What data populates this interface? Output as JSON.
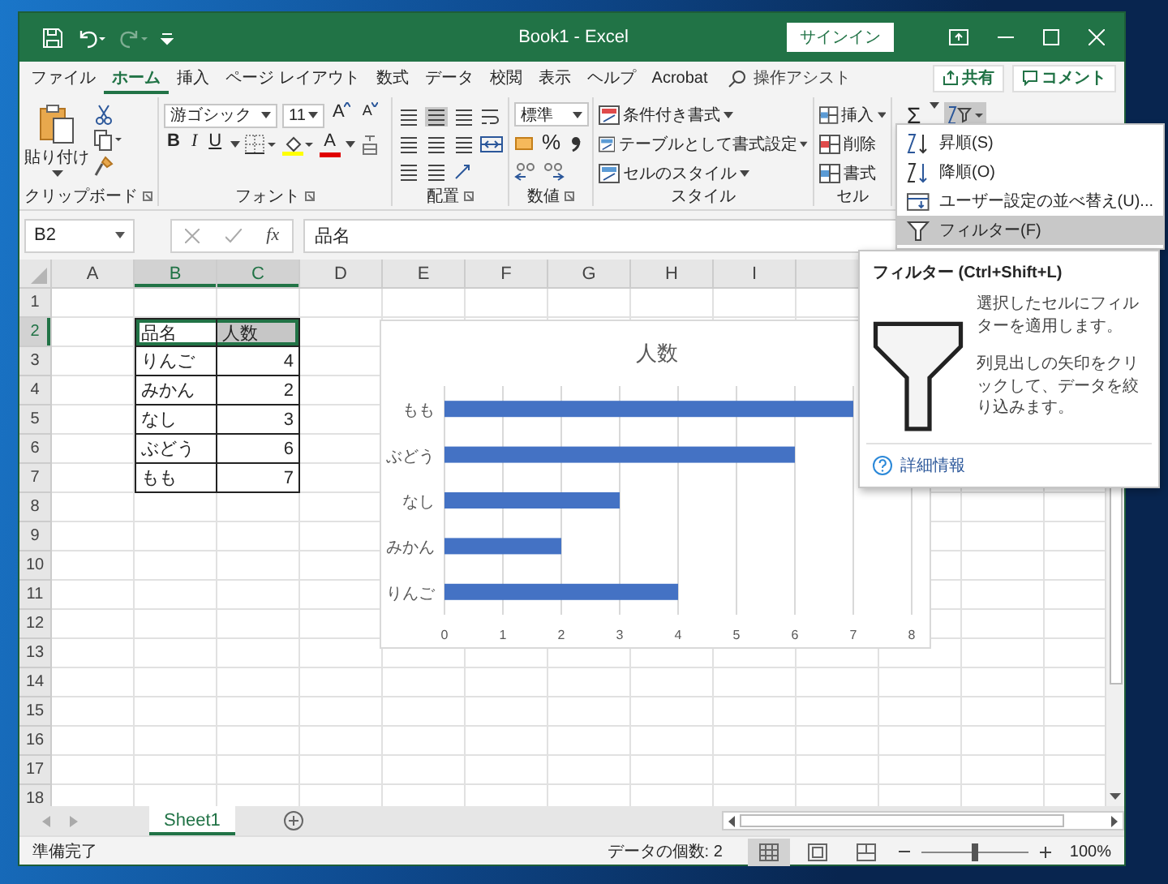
{
  "window": {
    "title": "Book1 - Excel",
    "sign_in": "サインイン"
  },
  "tabs": [
    {
      "label": "ファイル",
      "selected": false
    },
    {
      "label": "ホーム",
      "selected": true
    },
    {
      "label": "挿入",
      "selected": false
    },
    {
      "label": "ページ レイアウト",
      "selected": false
    },
    {
      "label": "数式",
      "selected": false
    },
    {
      "label": "データ",
      "selected": false
    },
    {
      "label": "校閲",
      "selected": false
    },
    {
      "label": "表示",
      "selected": false
    },
    {
      "label": "ヘルプ",
      "selected": false
    },
    {
      "label": "Acrobat",
      "selected": false
    }
  ],
  "tell_me": {
    "placeholder": "操作アシスト"
  },
  "share_button": "共有",
  "comment_button": "コメント",
  "ribbon": {
    "clipboard": {
      "paste": "貼り付け",
      "label": "クリップボード"
    },
    "font": {
      "name": "游ゴシック",
      "size": "11",
      "grow": "A",
      "shrink": "A",
      "bold": "B",
      "italic": "I",
      "underline": "U",
      "font_color": "A",
      "label": "フォント"
    },
    "alignment": {
      "label": "配置"
    },
    "number": {
      "format": "標準",
      "percent": "%",
      "label": "数値"
    },
    "styles": {
      "buttons": [
        "条件付き書式",
        "テーブルとして書式設定",
        "セルのスタイル"
      ],
      "label": "スタイル"
    },
    "cells": {
      "buttons": [
        "挿入",
        "削除",
        "書式"
      ],
      "label": "セル"
    },
    "editing": {
      "sum": "Σ"
    }
  },
  "sort_menu": {
    "items": [
      {
        "label": "昇順(S)",
        "selected": false
      },
      {
        "label": "降順(O)",
        "selected": false
      },
      {
        "label": "ユーザー設定の並べ替え(U)...",
        "selected": false
      },
      {
        "label": "フィルター(F)",
        "selected": true
      }
    ]
  },
  "tooltip": {
    "title": "フィルター (Ctrl+Shift+L)",
    "paragraphs": [
      "選択したセルにフィルターを適用します。",
      "列見出しの矢印をクリックして、データを絞り込みます。"
    ],
    "link": "詳細情報"
  },
  "formula_bar": {
    "name_box": "B2",
    "fx": "fx",
    "value": "品名"
  },
  "sheet": {
    "columns": [
      {
        "label": "A",
        "selected": false
      },
      {
        "label": "B",
        "selected": true
      },
      {
        "label": "C",
        "selected": true
      },
      {
        "label": "D",
        "selected": false
      },
      {
        "label": "E",
        "selected": false
      },
      {
        "label": "F",
        "selected": false
      },
      {
        "label": "G",
        "selected": false
      },
      {
        "label": "H",
        "selected": false
      },
      {
        "label": "I",
        "selected": false
      }
    ],
    "rows": [
      {
        "label": "1",
        "selected": false
      },
      {
        "label": "2",
        "selected": true
      },
      {
        "label": "3",
        "selected": false
      },
      {
        "label": "4",
        "selected": false
      },
      {
        "label": "5",
        "selected": false
      },
      {
        "label": "6",
        "selected": false
      },
      {
        "label": "7",
        "selected": false
      },
      {
        "label": "8",
        "selected": false
      },
      {
        "label": "9",
        "selected": false
      },
      {
        "label": "10",
        "selected": false
      },
      {
        "label": "11",
        "selected": false
      },
      {
        "label": "12",
        "selected": false
      },
      {
        "label": "13",
        "selected": false
      },
      {
        "label": "14",
        "selected": false
      },
      {
        "label": "15",
        "selected": false
      },
      {
        "label": "16",
        "selected": false
      },
      {
        "label": "17",
        "selected": false
      },
      {
        "label": "18",
        "selected": false
      }
    ]
  },
  "table": {
    "rows": [
      {
        "cells": [
          {
            "text": "品名",
            "kind": "text",
            "selected": true,
            "active": true
          },
          {
            "text": "人数",
            "kind": "text",
            "selected": true,
            "active": false
          }
        ]
      },
      {
        "cells": [
          {
            "text": "りんご",
            "kind": "text",
            "selected": false,
            "active": false
          },
          {
            "text": "4",
            "kind": "number",
            "selected": false,
            "active": false
          }
        ]
      },
      {
        "cells": [
          {
            "text": "みかん",
            "kind": "text",
            "selected": false,
            "active": false
          },
          {
            "text": "2",
            "kind": "number",
            "selected": false,
            "active": false
          }
        ]
      },
      {
        "cells": [
          {
            "text": "なし",
            "kind": "text",
            "selected": false,
            "active": false
          },
          {
            "text": "3",
            "kind": "number",
            "selected": false,
            "active": false
          }
        ]
      },
      {
        "cells": [
          {
            "text": "ぶどう",
            "kind": "text",
            "selected": false,
            "active": false
          },
          {
            "text": "6",
            "kind": "number",
            "selected": false,
            "active": false
          }
        ]
      },
      {
        "cells": [
          {
            "text": "もも",
            "kind": "text",
            "selected": false,
            "active": false
          },
          {
            "text": "7",
            "kind": "number",
            "selected": false,
            "active": false
          }
        ]
      }
    ]
  },
  "chart": {
    "chart_data": {
      "type": "bar",
      "orientation": "horizontal",
      "title": "人数",
      "categories": [
        "もも",
        "ぶどう",
        "なし",
        "みかん",
        "りんご"
      ],
      "series": [
        {
          "color": "#4472c4",
          "values": [
            7,
            6,
            3,
            2,
            4
          ]
        }
      ],
      "xlim": [
        0,
        8
      ],
      "xticks": [
        0,
        1,
        2,
        3,
        4,
        5,
        6,
        7,
        8
      ],
      "grid": true
    }
  },
  "sheet_tabs": [
    {
      "label": "Sheet1",
      "selected": true
    }
  ],
  "status_bar": {
    "mode": "準備完了",
    "count": "データの個数: 2",
    "views": [
      {
        "selected": true
      },
      {
        "selected": false
      },
      {
        "selected": false
      }
    ],
    "zoom_slider": {
      "level": 0.5
    },
    "zoom": "100%"
  }
}
